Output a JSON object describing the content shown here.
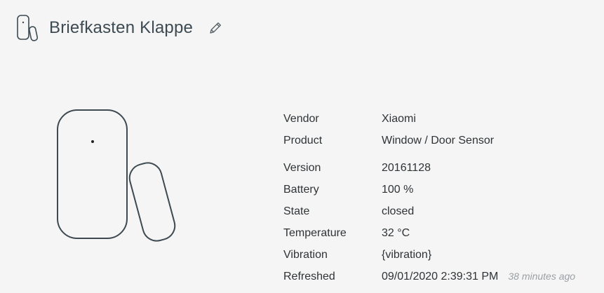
{
  "header": {
    "title": "Briefkasten Klappe",
    "device_icon": "door-sensor-icon",
    "edit_icon": "pencil-icon"
  },
  "details": [
    {
      "key": "Vendor",
      "value": "Xiaomi"
    },
    {
      "key": "Product",
      "value": "Window / Door Sensor"
    },
    {
      "key": "Version",
      "value": "20161128"
    },
    {
      "key": "Battery",
      "value": "100 %"
    },
    {
      "key": "State",
      "value": "closed"
    },
    {
      "key": "Temperature",
      "value": "32 °C"
    },
    {
      "key": "Vibration",
      "value": "{vibration}"
    },
    {
      "key": "Refreshed",
      "value": "09/01/2020 2:39:31 PM",
      "relative": "38 minutes ago"
    }
  ],
  "colors": {
    "background": "#f5f5f5",
    "title": "#3d4a52",
    "text": "#2f3336",
    "muted": "#9aa0a4",
    "stroke": "#3d4a52"
  }
}
